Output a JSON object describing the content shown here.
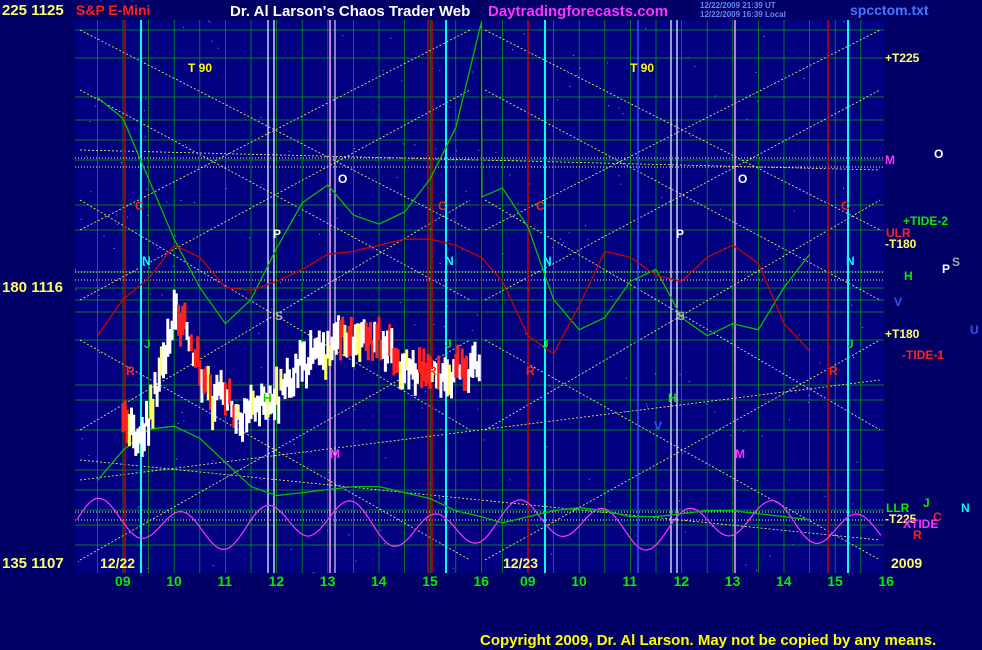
{
  "header": {
    "left_title": "S&P E-Mini",
    "center_title": "Dr. Al Larson's Chaos Trader Web",
    "site": "Daytradingforecasts.com",
    "timestamp_ut": "12/22/2009 21:39 UT",
    "timestamp_local": "12/22/2009 16:39 Local",
    "filename": "spcctom.txt"
  },
  "footer": {
    "copyright": "Copyright 2009, Dr. Al Larson. May not be copied by any means."
  },
  "colors": {
    "background": "#000066",
    "plot_background": "#000080",
    "price_up": "#FFFFFF",
    "price_highlight": "#FFFF66",
    "price_down": "#FF2020",
    "tide": "#00C000",
    "ulr": "#D00000",
    "oscillator": "#FF33FF",
    "diagonal": "#FFFF66",
    "grid": "#00AA00"
  },
  "chart_data": {
    "type": "line",
    "title": "S&P E-Mini",
    "y_axis": {
      "range": [
        1107,
        1125
      ],
      "tick_values": [
        1125,
        1116,
        1107
      ],
      "tick_labels": [
        "225 1125",
        "180 1116",
        "135 1107"
      ]
    },
    "x_axis": {
      "date_labels": [
        "12/22",
        "12/23",
        "2009"
      ],
      "hour_ticks": [
        "09",
        "10",
        "11",
        "12",
        "13",
        "14",
        "15",
        "16",
        "09",
        "10",
        "11",
        "12",
        "13",
        "14",
        "15",
        "16"
      ]
    },
    "right_labels": [
      "+T225",
      "M",
      "O",
      "+TIDE-2",
      "ULR",
      "-T180",
      "H",
      "P",
      "S",
      "V",
      "+T180",
      "U",
      "-TIDE-1",
      "LLR",
      "J",
      "N",
      "-T225",
      "C",
      "XTIDE",
      "R"
    ],
    "event_markers": [
      "T 90",
      "O",
      "C",
      "P",
      "N",
      "S",
      "J",
      "R",
      "H",
      "M",
      "V",
      "U"
    ],
    "series": [
      {
        "name": "Price",
        "points": [
          [
            9.0,
            1112.2
          ],
          [
            9.25,
            1111.0
          ],
          [
            9.5,
            1112.0
          ],
          [
            9.75,
            1113.5
          ],
          [
            10.0,
            1115.2
          ],
          [
            10.25,
            1114.8
          ],
          [
            10.5,
            1113.5
          ],
          [
            10.75,
            1112.5
          ],
          [
            11.0,
            1112.8
          ],
          [
            11.25,
            1111.8
          ],
          [
            11.5,
            1112.2
          ],
          [
            11.75,
            1112.4
          ],
          [
            12.0,
            1112.6
          ],
          [
            12.25,
            1113.0
          ],
          [
            12.5,
            1113.6
          ],
          [
            12.75,
            1114.0
          ],
          [
            13.0,
            1114.2
          ],
          [
            13.25,
            1114.5
          ],
          [
            13.5,
            1114.2
          ],
          [
            13.75,
            1114.6
          ],
          [
            14.0,
            1114.4
          ],
          [
            14.25,
            1114.0
          ],
          [
            14.5,
            1113.6
          ],
          [
            14.75,
            1113.6
          ],
          [
            15.0,
            1113.4
          ],
          [
            15.25,
            1113.0
          ],
          [
            15.5,
            1113.4
          ],
          [
            15.75,
            1113.3
          ],
          [
            16.0,
            1113.6
          ]
        ]
      },
      {
        "name": "+TIDE-2",
        "points": [
          [
            8.5,
            1122.5
          ],
          [
            9.0,
            1121.8
          ],
          [
            9.5,
            1119.8
          ],
          [
            10.0,
            1117.8
          ],
          [
            10.5,
            1116.2
          ],
          [
            11.0,
            1115.0
          ],
          [
            11.5,
            1115.8
          ],
          [
            12.0,
            1117.5
          ],
          [
            12.5,
            1119.0
          ],
          [
            13.0,
            1119.6
          ],
          [
            13.5,
            1118.6
          ],
          [
            14.0,
            1118.3
          ],
          [
            14.5,
            1118.7
          ],
          [
            15.0,
            1119.8
          ],
          [
            15.5,
            1121.5
          ],
          [
            16.0,
            1125.0
          ],
          [
            16.1,
            1119.2
          ],
          [
            16.5,
            1119.5
          ],
          [
            17.0,
            1118.2
          ],
          [
            17.5,
            1115.8
          ],
          [
            18.0,
            1114.8
          ],
          [
            18.5,
            1115.2
          ],
          [
            19.0,
            1116.4
          ],
          [
            19.5,
            1116.8
          ],
          [
            20.0,
            1115.2
          ],
          [
            20.5,
            1114.6
          ],
          [
            21.0,
            1115.0
          ],
          [
            21.5,
            1114.8
          ],
          [
            22.0,
            1116.2
          ],
          [
            22.5,
            1117.3
          ]
        ]
      },
      {
        "name": "ULR",
        "points": [
          [
            8.5,
            1114.6
          ],
          [
            9.0,
            1115.8
          ],
          [
            9.5,
            1116.5
          ],
          [
            10.0,
            1117.6
          ],
          [
            10.5,
            1117.2
          ],
          [
            11.0,
            1116.2
          ],
          [
            11.5,
            1116.1
          ],
          [
            12.0,
            1116.4
          ],
          [
            12.5,
            1116.8
          ],
          [
            13.0,
            1117.3
          ],
          [
            13.5,
            1117.4
          ],
          [
            14.0,
            1117.6
          ],
          [
            14.5,
            1117.8
          ],
          [
            15.0,
            1117.8
          ],
          [
            15.5,
            1117.6
          ],
          [
            16.0,
            1117.2
          ],
          [
            16.5,
            1116.4
          ],
          [
            17.0,
            1114.6
          ],
          [
            17.5,
            1114.0
          ],
          [
            18.0,
            1115.6
          ],
          [
            18.5,
            1117.4
          ],
          [
            19.0,
            1117.2
          ],
          [
            19.5,
            1116.6
          ],
          [
            20.0,
            1116.4
          ],
          [
            20.5,
            1117.2
          ],
          [
            21.0,
            1117.6
          ],
          [
            21.5,
            1117.0
          ],
          [
            22.0,
            1115.0
          ],
          [
            22.5,
            1114.1
          ]
        ]
      },
      {
        "name": "LLR",
        "points": [
          [
            8.5,
            1109.8
          ],
          [
            9.0,
            1110.8
          ],
          [
            9.5,
            1111.5
          ],
          [
            10.0,
            1111.6
          ],
          [
            10.5,
            1111.2
          ],
          [
            11.0,
            1110.4
          ],
          [
            11.5,
            1109.6
          ],
          [
            12.0,
            1109.3
          ],
          [
            12.5,
            1109.4
          ],
          [
            13.0,
            1109.5
          ],
          [
            13.5,
            1109.6
          ],
          [
            14.0,
            1109.6
          ],
          [
            14.5,
            1109.4
          ],
          [
            15.0,
            1109.2
          ],
          [
            15.5,
            1108.8
          ],
          [
            16.0,
            1108.6
          ],
          [
            16.5,
            1108.4
          ],
          [
            17.0,
            1108.6
          ],
          [
            17.5,
            1108.8
          ],
          [
            18.0,
            1108.9
          ],
          [
            18.5,
            1108.8
          ],
          [
            19.0,
            1108.6
          ],
          [
            19.5,
            1108.6
          ],
          [
            20.0,
            1108.7
          ],
          [
            20.5,
            1108.8
          ],
          [
            21.0,
            1108.8
          ],
          [
            21.5,
            1108.7
          ],
          [
            22.0,
            1108.6
          ],
          [
            22.5,
            1108.5
          ]
        ]
      }
    ]
  }
}
